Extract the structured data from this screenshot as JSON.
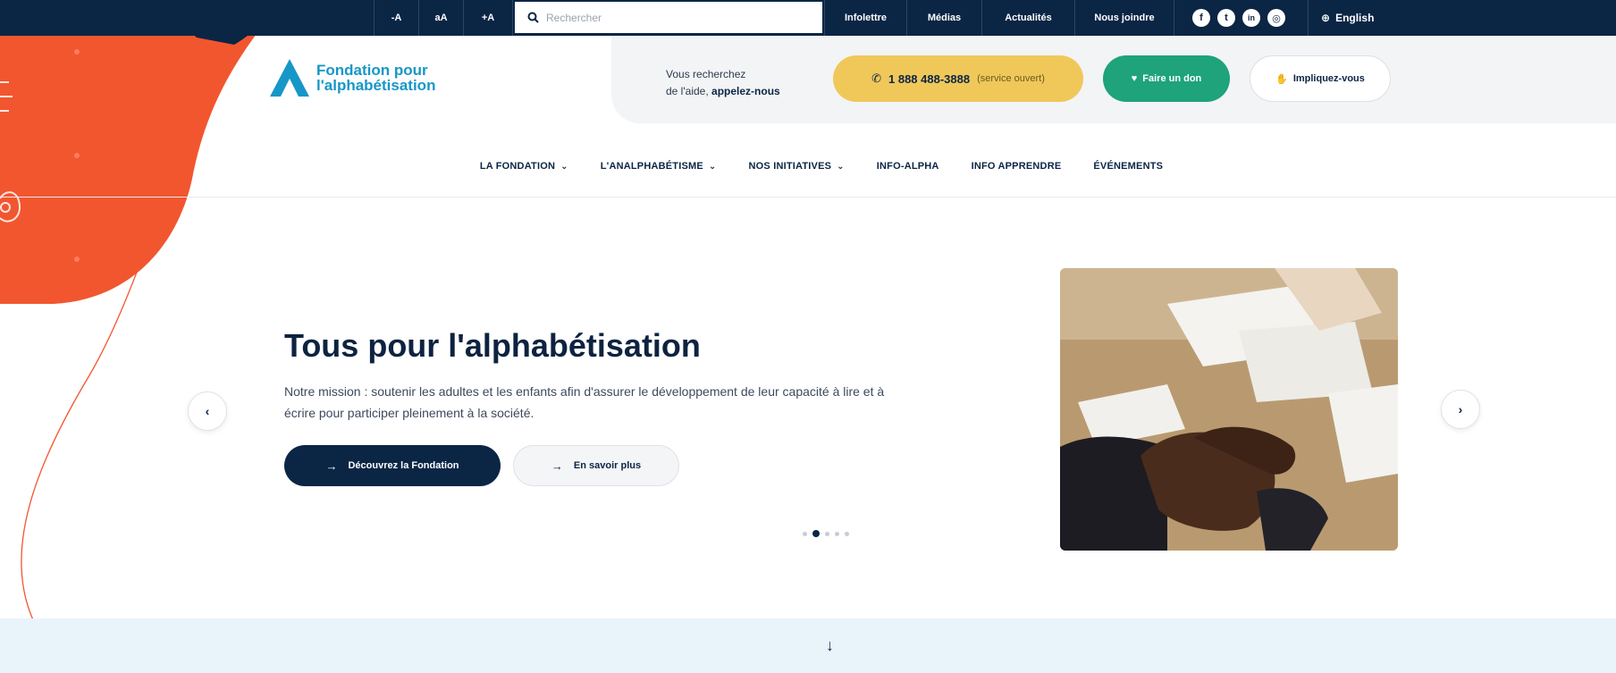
{
  "topbar": {
    "font_decrease": "-A",
    "font_reset": "aA",
    "font_increase": "+A",
    "search_placeholder": "Rechercher",
    "links": [
      "Infolettre",
      "Médias",
      "Actualités",
      "Nous joindre"
    ],
    "social_icons": [
      "facebook-icon",
      "twitter-icon",
      "linkedin-icon",
      "instagram-icon"
    ],
    "language": "English"
  },
  "header": {
    "logo_line1": "Fondation pour",
    "logo_line2": "l'alphabétisation",
    "help_line1": "Vous recherchez",
    "help_line2_prefix": "de l'aide,",
    "help_line2_bold": "appelez-nous",
    "phone": "1 888 488-3888",
    "phone_status": "(service ouvert)",
    "donate": "Faire un don",
    "involve": "Impliquez-vous"
  },
  "nav": {
    "items": [
      {
        "label": "LA FONDATION",
        "has_menu": true
      },
      {
        "label": "L'ANALPHABÉTISME",
        "has_menu": true
      },
      {
        "label": "NOS INITIATIVES",
        "has_menu": true
      },
      {
        "label": "INFO-ALPHA",
        "has_menu": false
      },
      {
        "label": "INFO APPRENDRE",
        "has_menu": false
      },
      {
        "label": "ÉVÉNEMENTS",
        "has_menu": false
      }
    ]
  },
  "hero": {
    "title": "Tous pour l'alphabétisation",
    "description": "Notre mission : soutenir les adultes et les enfants afin d'assurer le développement de leur capacité à lire et à écrire pour participer pleinement à la société.",
    "cta_primary": "Découvrez la Fondation",
    "cta_secondary": "En savoir plus",
    "slide_count": 5,
    "active_slide": 2
  },
  "colors": {
    "navy": "#0b2545",
    "accent_blue": "#1797c7",
    "orange": "#f2562f",
    "yellow": "#f0c85a",
    "green": "#1ea37b"
  }
}
